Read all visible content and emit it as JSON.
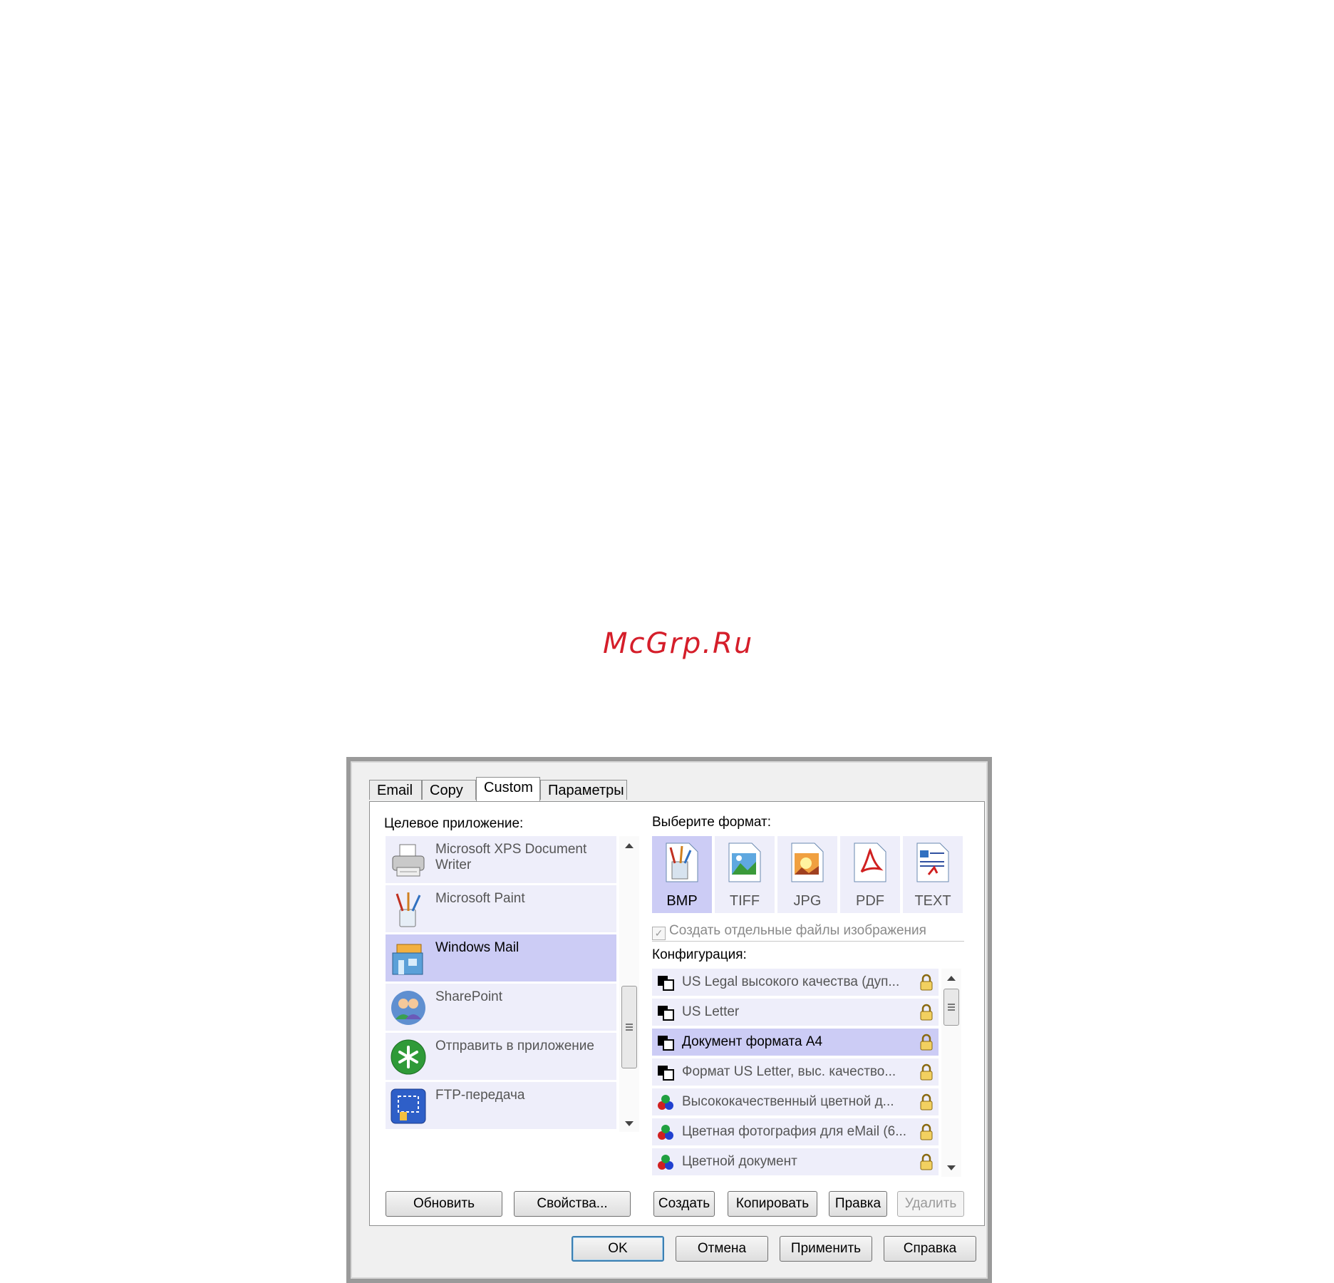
{
  "watermark": "McGrp.Ru",
  "tabs": [
    {
      "label": "Email"
    },
    {
      "label": "Copy"
    },
    {
      "label": "Custom"
    },
    {
      "label": "Параметры"
    }
  ],
  "active_tab": "Custom",
  "target_app": {
    "label": "Целевое приложение:",
    "items": [
      {
        "label": "Microsoft XPS Document Writer",
        "icon": "printer-icon"
      },
      {
        "label": "Microsoft Paint",
        "icon": "paint-brushes-icon"
      },
      {
        "label": "Windows Mail",
        "icon": "windows-mail-icon",
        "selected": true
      },
      {
        "label": "SharePoint",
        "icon": "sharepoint-users-icon"
      },
      {
        "label": "Отправить в приложение",
        "icon": "send-to-app-icon"
      },
      {
        "label": "FTP-передача",
        "icon": "ftp-icon"
      }
    ],
    "buttons": {
      "refresh": "Обновить",
      "properties": "Свойства..."
    }
  },
  "format": {
    "label": "Выберите формат:",
    "items": [
      {
        "label": "BMP",
        "selected": true
      },
      {
        "label": "TIFF"
      },
      {
        "label": "JPG"
      },
      {
        "label": "PDF"
      },
      {
        "label": "TEXT"
      }
    ],
    "separate_files_label": "Создать отдельные файлы изображения",
    "separate_files_checked": true
  },
  "configuration": {
    "label": "Конфигурация:",
    "items": [
      {
        "label": "US Legal высокого качества (дуп...",
        "kind": "bw"
      },
      {
        "label": "US Letter",
        "kind": "bw"
      },
      {
        "label": "Документ формата A4",
        "kind": "bw",
        "selected": true
      },
      {
        "label": "Формат US Letter, выс. качество...",
        "kind": "bw"
      },
      {
        "label": "Высококачественный цветной д...",
        "kind": "color"
      },
      {
        "label": "Цветная фотография для eMail (6...",
        "kind": "color"
      },
      {
        "label": "Цветной документ",
        "kind": "color"
      }
    ],
    "buttons": {
      "create": "Создать",
      "copy": "Копировать",
      "edit": "Правка",
      "delete": "Удалить"
    }
  },
  "footer": {
    "ok": "OK",
    "cancel": "Отмена",
    "apply": "Применить",
    "help": "Справка"
  },
  "colors": {
    "selected_bg": "#ccccf5",
    "item_bg": "#eeeefa",
    "watermark": "#d51e2a"
  }
}
